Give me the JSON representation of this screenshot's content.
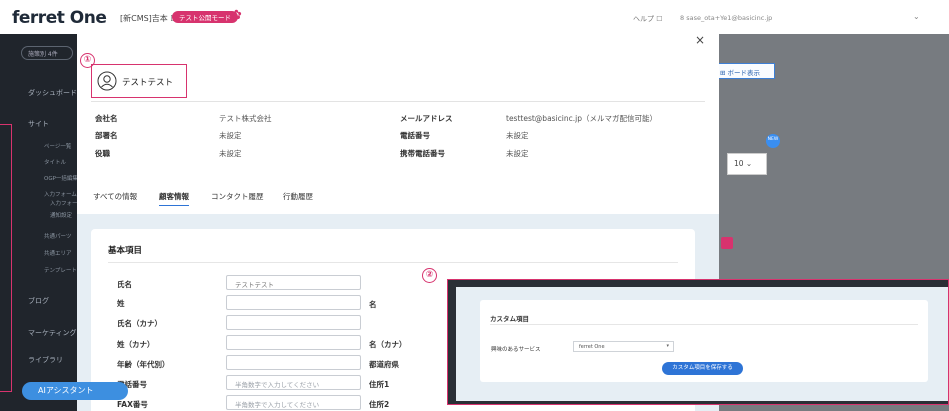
{
  "app": {
    "brand": "ferret One",
    "project": "[新CMS]吉本 ☐",
    "mode_badge": "テスト公開モード",
    "help": "ヘルプ ☐",
    "user": "8 sase_ota+Ye1@basicinc.jp"
  },
  "sidebar": {
    "filter": "施策別 4件",
    "items": [
      "ダッシュボード",
      "サイト",
      "ブログ",
      "マーケティング",
      "ライブラリ"
    ],
    "sub_items": [
      "ページ一覧",
      "タイトル",
      "OGP一括編集",
      "入力フォーム",
      "入力フォーム",
      "通知設定",
      "共通パーツ",
      "共通エリア",
      "テンプレート"
    ]
  },
  "ai_assistant": {
    "label": "AIアシスタント"
  },
  "background": {
    "board_button": "⊞ ボード表示",
    "per_page": "10",
    "new_badge": "NEW"
  },
  "modal": {
    "close": "×",
    "marker_1": "①",
    "marker_2": "②",
    "contact": {
      "name": "テストテスト",
      "icon": "person-outline-icon"
    },
    "info_fields": [
      {
        "label": "会社名",
        "value": "テスト株式会社"
      },
      {
        "label": "部署名",
        "value": "未設定"
      },
      {
        "label": "役職",
        "value": "未設定"
      },
      {
        "label": "メールアドレス",
        "value": "testtest@basicinc.jp（メルマガ配信可能）"
      },
      {
        "label": "電話番号",
        "value": "未設定"
      },
      {
        "label": "携帯電話番号",
        "value": "未設定"
      }
    ],
    "tabs": [
      "すべての情報",
      "顧客情報",
      "コンタクト履歴",
      "行動履歴"
    ],
    "active_tab": "顧客情報",
    "basic_section": {
      "title": "基本項目",
      "left_fields": [
        {
          "label": "氏名",
          "value": "テストテスト",
          "placeholder": ""
        },
        {
          "label": "姓",
          "value": "",
          "placeholder": ""
        },
        {
          "label": "氏名（カナ）",
          "value": "",
          "placeholder": ""
        },
        {
          "label": "姓（カナ）",
          "value": "",
          "placeholder": ""
        },
        {
          "label": "年齢（年代別）",
          "value": "",
          "placeholder": ""
        },
        {
          "label": "電話番号",
          "value": "",
          "placeholder": "半角数字で入力してください"
        },
        {
          "label": "FAX番号",
          "value": "",
          "placeholder": "半角数字で入力してください"
        }
      ],
      "right_labels": [
        "名",
        "名（カナ）",
        "都道府県",
        "住所1",
        "住所2"
      ]
    }
  },
  "callout": {
    "title": "カスタム項目",
    "field_label": "興味のあるサービス",
    "select_value": "ferret One",
    "save_button": "カスタム項目を保存する"
  },
  "colors": {
    "accent_pink": "#d7336e",
    "primary_blue": "#2e74d6",
    "sidebar_bg": "#20252c"
  }
}
